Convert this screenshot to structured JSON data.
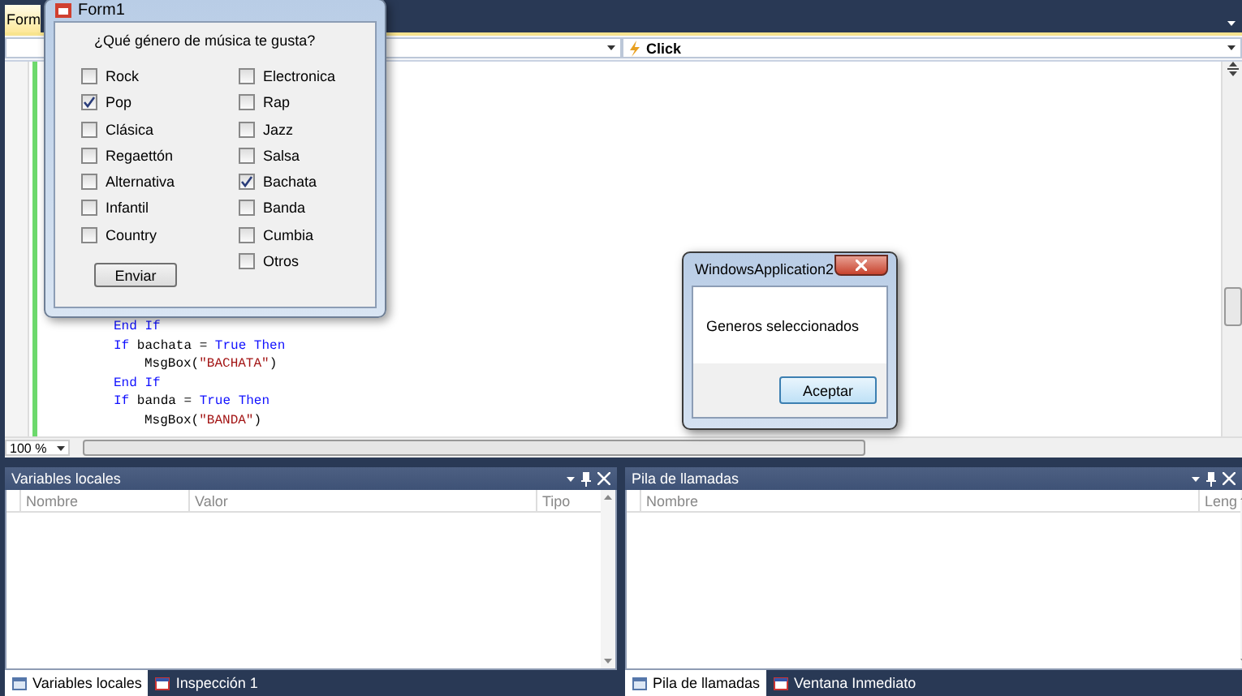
{
  "document_tab": {
    "label": "Form",
    "selected": true
  },
  "event_dropdown": {
    "value": "Click"
  },
  "code_lines": [
    {
      "kind": "statement",
      "tokens": [
        {
          "kind": "keyword",
          "text": "End If"
        }
      ]
    },
    {
      "kind": "statement",
      "tokens": [
        {
          "kind": "keyword",
          "text": "If"
        },
        {
          "kind": "plain",
          "text": " bachata = "
        },
        {
          "kind": "keyword",
          "text": "True Then"
        }
      ]
    },
    {
      "kind": "body",
      "tokens": [
        {
          "kind": "plain",
          "text": "MsgBox("
        },
        {
          "kind": "string",
          "text": "\"BACHATA\""
        },
        {
          "kind": "plain",
          "text": ")"
        }
      ]
    },
    {
      "kind": "statement",
      "tokens": [
        {
          "kind": "keyword",
          "text": "End If"
        }
      ]
    },
    {
      "kind": "statement",
      "tokens": [
        {
          "kind": "keyword",
          "text": "If"
        },
        {
          "kind": "plain",
          "text": " banda = "
        },
        {
          "kind": "keyword",
          "text": "True Then"
        }
      ]
    },
    {
      "kind": "body",
      "tokens": [
        {
          "kind": "plain",
          "text": "MsgBox("
        },
        {
          "kind": "string",
          "text": "\"BANDA\""
        },
        {
          "kind": "plain",
          "text": ")"
        }
      ]
    }
  ],
  "zoom": {
    "value": "100 %"
  },
  "form_window": {
    "title": "Form1",
    "question": "¿Qué género de música te gusta?",
    "columns": [
      [
        {
          "label": "Rock",
          "checked": false
        },
        {
          "label": "Pop",
          "checked": true
        },
        {
          "label": "Clásica",
          "checked": false
        },
        {
          "label": "Regaettón",
          "checked": false
        },
        {
          "label": "Alternativa",
          "checked": false
        },
        {
          "label": "Infantil",
          "checked": false
        },
        {
          "label": "Country",
          "checked": false
        }
      ],
      [
        {
          "label": "Electronica",
          "checked": false
        },
        {
          "label": "Rap",
          "checked": false
        },
        {
          "label": "Jazz",
          "checked": false
        },
        {
          "label": "Salsa",
          "checked": false
        },
        {
          "label": "Bachata",
          "checked": true
        },
        {
          "label": "Banda",
          "checked": false
        },
        {
          "label": "Cumbia",
          "checked": false
        },
        {
          "label": "Otros",
          "checked": false
        }
      ]
    ],
    "button": "Enviar"
  },
  "message_box": {
    "title": "WindowsApplication2",
    "message": "Generos seleccionados",
    "button": "Aceptar"
  },
  "panels": [
    {
      "title": "Variables locales",
      "columns": [
        "Nombre",
        "Valor",
        "Tipo"
      ],
      "tabs": [
        {
          "label": "Variables locales",
          "selected": true
        },
        {
          "label": "Inspección 1",
          "selected": false
        }
      ]
    },
    {
      "title": "Pila de llamadas",
      "columns": [
        "Nombre",
        "Leng"
      ],
      "tabs": [
        {
          "label": "Pila de llamadas",
          "selected": true
        },
        {
          "label": "Ventana Inmediato",
          "selected": false
        }
      ]
    }
  ]
}
